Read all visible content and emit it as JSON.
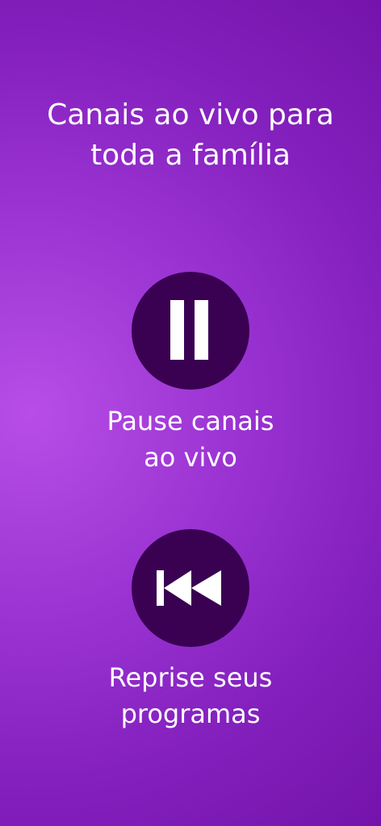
{
  "headline": {
    "line1": "Canais ao vivo para",
    "line2": "toda a família"
  },
  "features": [
    {
      "icon": "pause-icon",
      "label_line1": "Pause canais",
      "label_line2": "ao vivo"
    },
    {
      "icon": "rewind-icon",
      "label_line1": "Reprise seus",
      "label_line2": "programas"
    }
  ],
  "colors": {
    "background_light": "#b84ee6",
    "background_dark": "#7413ab",
    "button_fill": "#3a0052",
    "icon": "#ffffff",
    "text": "#ffffff"
  }
}
